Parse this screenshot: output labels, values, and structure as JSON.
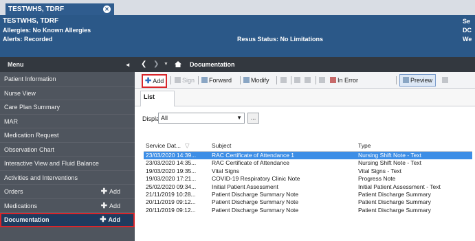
{
  "patient_tab": {
    "name": "TESTWHS, TDRF",
    "close_icon": "close-icon"
  },
  "banner": {
    "name": "TESTWHS, TDRF",
    "allergies": "Allergies: No Known Allergies",
    "alerts": "Alerts: Recorded",
    "resus": "Resus Status: No Limitations",
    "right_lines": [
      "Se",
      "DC",
      "We"
    ],
    "color": "#2b5888"
  },
  "menu": {
    "header": "Menu",
    "pin_icon": "pin-icon",
    "items": [
      {
        "label": "Patient Information",
        "add": ""
      },
      {
        "label": "Nurse View",
        "add": ""
      },
      {
        "label": "Care Plan Summary",
        "add": ""
      },
      {
        "label": "MAR",
        "add": ""
      },
      {
        "label": "Medication Request",
        "add": ""
      },
      {
        "label": "Observation Chart",
        "add": ""
      },
      {
        "label": "Interactive View and Fluid Balance",
        "add": ""
      },
      {
        "label": "Activities and Interventions",
        "add": ""
      },
      {
        "label": "Orders",
        "add": "Add"
      },
      {
        "label": "Medications",
        "add": "Add"
      },
      {
        "label": "Documentation",
        "add": "Add",
        "active": true
      }
    ]
  },
  "navbar": {
    "title": "Documentation",
    "back_icon": "back-arrow-icon",
    "forward_icon": "forward-arrow-icon",
    "home_icon": "home-icon"
  },
  "toolbar": {
    "add": "Add",
    "sign": "Sign",
    "forward": "Forward",
    "modify": "Modify",
    "in_error": "In Error",
    "preview": "Preview"
  },
  "tabs": {
    "list": "List"
  },
  "filter": {
    "label": "Display",
    "value": "All",
    "more": "..."
  },
  "table": {
    "columns": [
      "Service Dat...",
      "Subject",
      "Type"
    ],
    "rows": [
      {
        "date": "23/03/2020 14:39...",
        "subject": "RAC Certificate of Attendance 1",
        "type": "Nursing Shift Note - Text",
        "selected": true
      },
      {
        "date": "23/03/2020 14:35...",
        "subject": "RAC Certificate of Attendance",
        "type": "Nursing Shift Note - Text"
      },
      {
        "date": "19/03/2020 19:35...",
        "subject": "Vital Signs",
        "type": "Vital Signs - Text"
      },
      {
        "date": "19/03/2020 17:21...",
        "subject": "COVID-19 Respiratory Clinic Note",
        "type": "Progress Note"
      },
      {
        "date": "25/02/2020 09:34...",
        "subject": "Initial Patient Assessment",
        "type": "Initial Patient Assessment - Text"
      },
      {
        "date": "21/11/2019 10:28...",
        "subject": "Patient Discharge Summary Note",
        "type": "Patient Discharge Summary"
      },
      {
        "date": "20/11/2019 09:12...",
        "subject": "Patient Discharge Summary Note",
        "type": "Patient Discharge Summary"
      },
      {
        "date": "20/11/2019 09:12...",
        "subject": "Patient Discharge Summary Note",
        "type": "Patient Discharge Summary"
      }
    ]
  },
  "colors": {
    "highlight": "#d9262b",
    "selected_row": "#3d8ee6",
    "menu_bg": "#4f555e"
  }
}
